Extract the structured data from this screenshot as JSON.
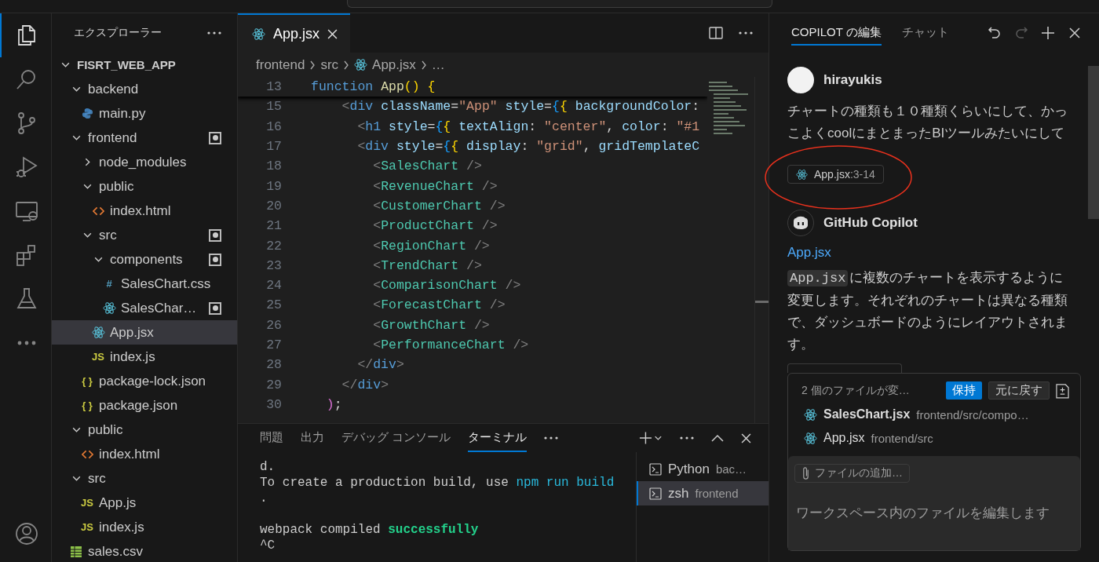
{
  "activity_bar": [
    {
      "kind": "explorer",
      "selected": true
    },
    {
      "kind": "search",
      "selected": false
    },
    {
      "kind": "source-control",
      "selected": false
    },
    {
      "kind": "run-debug",
      "selected": false
    },
    {
      "kind": "remote",
      "selected": false
    },
    {
      "kind": "extensions",
      "selected": false
    },
    {
      "kind": "testing",
      "selected": false
    },
    {
      "kind": "more",
      "selected": false
    },
    {
      "kind": "account",
      "selected": false
    }
  ],
  "explorer": {
    "title": "エクスプローラー",
    "tree": [
      {
        "name": "FISRT_WEB_APP",
        "kind": "workspace",
        "expanded": true,
        "modified": false,
        "selected": false,
        "children": [
          {
            "name": "backend",
            "kind": "folder",
            "expanded": true,
            "modified": false,
            "selected": false,
            "children": [
              {
                "name": "main.py",
                "kind": "python",
                "modified": false,
                "selected": false
              }
            ]
          },
          {
            "name": "frontend",
            "kind": "folder",
            "expanded": true,
            "modified": true,
            "selected": false,
            "children": [
              {
                "name": "node_modules",
                "kind": "folder",
                "expanded": false,
                "modified": false,
                "selected": false
              },
              {
                "name": "public",
                "kind": "folder",
                "expanded": true,
                "modified": false,
                "selected": false,
                "children": [
                  {
                    "name": "index.html",
                    "kind": "html",
                    "modified": false,
                    "selected": false
                  }
                ]
              },
              {
                "name": "src",
                "kind": "folder",
                "expanded": true,
                "modified": true,
                "selected": false,
                "children": [
                  {
                    "name": "components",
                    "kind": "folder",
                    "expanded": true,
                    "modified": true,
                    "selected": false,
                    "children": [
                      {
                        "name": "SalesChart.css",
                        "kind": "glyph",
                        "glyph": "#",
                        "modified": false,
                        "selected": false
                      },
                      {
                        "name": "SalesChar…",
                        "kind": "react",
                        "modified": true,
                        "selected": false
                      }
                    ]
                  },
                  {
                    "name": "App.jsx",
                    "kind": "react",
                    "modified": false,
                    "selected": true
                  },
                  {
                    "name": "index.js",
                    "kind": "glyph",
                    "glyph": "JS",
                    "modified": false,
                    "selected": false
                  }
                ]
              },
              {
                "name": "package-lock.json",
                "kind": "glyph",
                "glyph": "{ }",
                "modified": false,
                "selected": false
              },
              {
                "name": "package.json",
                "kind": "glyph",
                "glyph": "{ }",
                "modified": false,
                "selected": false
              }
            ]
          },
          {
            "name": "public",
            "kind": "folder",
            "expanded": true,
            "modified": false,
            "selected": false,
            "children": [
              {
                "name": "index.html",
                "kind": "html",
                "modified": false,
                "selected": false
              }
            ]
          },
          {
            "name": "src",
            "kind": "folder",
            "expanded": true,
            "modified": false,
            "selected": false,
            "children": [
              {
                "name": "App.js",
                "kind": "glyph",
                "glyph": "JS",
                "modified": false,
                "selected": false
              },
              {
                "name": "index.js",
                "kind": "glyph",
                "glyph": "JS",
                "modified": false,
                "selected": false
              }
            ]
          },
          {
            "name": "sales.csv",
            "kind": "csv",
            "modified": false,
            "selected": false
          }
        ]
      }
    ]
  },
  "editor": {
    "tabs": [
      {
        "label": "App.jsx",
        "kind": "react",
        "selected": true
      }
    ],
    "breadcrumbs": [
      {
        "text": "frontend",
        "kind": "plain"
      },
      {
        "text": "src",
        "kind": "plain"
      },
      {
        "text": "App.jsx",
        "kind": "react"
      },
      {
        "text": "…",
        "kind": "plain"
      }
    ],
    "sticky_line": {
      "number": "13",
      "tokens": [
        {
          "kind": "keyword",
          "text": "function "
        },
        {
          "kind": "func",
          "text": "App"
        },
        {
          "kind": "brace1",
          "text": "() {"
        }
      ]
    },
    "lines": [
      {
        "number": "15",
        "tokens": [
          {
            "kind": "bracket",
            "text": "    <"
          },
          {
            "kind": "tag",
            "text": "div"
          },
          {
            "kind": "attr",
            "text": " className"
          },
          {
            "kind": "punct",
            "text": "="
          },
          {
            "kind": "string",
            "text": "\"App\""
          },
          {
            "kind": "attr",
            "text": " style"
          },
          {
            "kind": "punct",
            "text": "="
          },
          {
            "kind": "brace3",
            "text": "{"
          },
          {
            "kind": "brace1",
            "text": "{"
          },
          {
            "kind": "attr",
            "text": " backgroundColor"
          },
          {
            "kind": "punct",
            "text": ":"
          }
        ]
      },
      {
        "number": "16",
        "tokens": [
          {
            "kind": "bracket",
            "text": "      <"
          },
          {
            "kind": "tag",
            "text": "h1"
          },
          {
            "kind": "attr",
            "text": " style"
          },
          {
            "kind": "punct",
            "text": "="
          },
          {
            "kind": "brace3",
            "text": "{"
          },
          {
            "kind": "brace1",
            "text": "{"
          },
          {
            "kind": "attr",
            "text": " textAlign"
          },
          {
            "kind": "punct",
            "text": ": "
          },
          {
            "kind": "string",
            "text": "\"center\""
          },
          {
            "kind": "punct",
            "text": ", "
          },
          {
            "kind": "attr",
            "text": "color"
          },
          {
            "kind": "punct",
            "text": ": "
          },
          {
            "kind": "string",
            "text": "\"#1"
          }
        ]
      },
      {
        "number": "17",
        "tokens": [
          {
            "kind": "bracket",
            "text": "      <"
          },
          {
            "kind": "tag",
            "text": "div"
          },
          {
            "kind": "attr",
            "text": " style"
          },
          {
            "kind": "punct",
            "text": "="
          },
          {
            "kind": "brace3",
            "text": "{"
          },
          {
            "kind": "brace1",
            "text": "{"
          },
          {
            "kind": "attr",
            "text": " display"
          },
          {
            "kind": "punct",
            "text": ": "
          },
          {
            "kind": "string",
            "text": "\"grid\""
          },
          {
            "kind": "punct",
            "text": ", "
          },
          {
            "kind": "attr",
            "text": "gridTemplateC"
          }
        ]
      },
      {
        "number": "18",
        "tokens": [
          {
            "kind": "bracket",
            "text": "        <"
          },
          {
            "kind": "component",
            "text": "SalesChart"
          },
          {
            "kind": "bracket",
            "text": " />"
          }
        ]
      },
      {
        "number": "19",
        "tokens": [
          {
            "kind": "bracket",
            "text": "        <"
          },
          {
            "kind": "component",
            "text": "RevenueChart"
          },
          {
            "kind": "bracket",
            "text": " />"
          }
        ]
      },
      {
        "number": "20",
        "tokens": [
          {
            "kind": "bracket",
            "text": "        <"
          },
          {
            "kind": "component",
            "text": "CustomerChart"
          },
          {
            "kind": "bracket",
            "text": " />"
          }
        ]
      },
      {
        "number": "21",
        "tokens": [
          {
            "kind": "bracket",
            "text": "        <"
          },
          {
            "kind": "component",
            "text": "ProductChart"
          },
          {
            "kind": "bracket",
            "text": " />"
          }
        ]
      },
      {
        "number": "22",
        "tokens": [
          {
            "kind": "bracket",
            "text": "        <"
          },
          {
            "kind": "component",
            "text": "RegionChart"
          },
          {
            "kind": "bracket",
            "text": " />"
          }
        ]
      },
      {
        "number": "23",
        "tokens": [
          {
            "kind": "bracket",
            "text": "        <"
          },
          {
            "kind": "component",
            "text": "TrendChart"
          },
          {
            "kind": "bracket",
            "text": " />"
          }
        ]
      },
      {
        "number": "24",
        "tokens": [
          {
            "kind": "bracket",
            "text": "        <"
          },
          {
            "kind": "component",
            "text": "ComparisonChart"
          },
          {
            "kind": "bracket",
            "text": " />"
          }
        ]
      },
      {
        "number": "25",
        "tokens": [
          {
            "kind": "bracket",
            "text": "        <"
          },
          {
            "kind": "component",
            "text": "ForecastChart"
          },
          {
            "kind": "bracket",
            "text": " />"
          }
        ]
      },
      {
        "number": "26",
        "tokens": [
          {
            "kind": "bracket",
            "text": "        <"
          },
          {
            "kind": "component",
            "text": "GrowthChart"
          },
          {
            "kind": "bracket",
            "text": " />"
          }
        ]
      },
      {
        "number": "27",
        "tokens": [
          {
            "kind": "bracket",
            "text": "        <"
          },
          {
            "kind": "component",
            "text": "PerformanceChart"
          },
          {
            "kind": "bracket",
            "text": " />"
          }
        ]
      },
      {
        "number": "28",
        "tokens": [
          {
            "kind": "bracket",
            "text": "      </"
          },
          {
            "kind": "tag",
            "text": "div"
          },
          {
            "kind": "bracket",
            "text": ">"
          }
        ]
      },
      {
        "number": "29",
        "tokens": [
          {
            "kind": "bracket",
            "text": "    </"
          },
          {
            "kind": "tag",
            "text": "div"
          },
          {
            "kind": "bracket",
            "text": ">"
          }
        ]
      },
      {
        "number": "30",
        "tokens": [
          {
            "kind": "brace2",
            "text": "  )"
          },
          {
            "kind": "punct",
            "text": ";"
          }
        ]
      }
    ]
  },
  "panel": {
    "tabs": [
      {
        "label": "問題",
        "selected": false
      },
      {
        "label": "出力",
        "selected": false
      },
      {
        "label": "デバッグ コンソール",
        "selected": false
      },
      {
        "label": "ターミナル",
        "selected": true
      }
    ],
    "terminal": [
      {
        "kind": "text",
        "segments": [
          {
            "kind": "plain",
            "text": "d."
          }
        ]
      },
      {
        "kind": "text",
        "segments": [
          {
            "kind": "plain",
            "text": "To create a production build, use "
          },
          {
            "kind": "command",
            "text": "npm run build"
          }
        ]
      },
      {
        "kind": "text",
        "segments": [
          {
            "kind": "plain",
            "text": "."
          }
        ]
      },
      {
        "kind": "blank"
      },
      {
        "kind": "text",
        "segments": [
          {
            "kind": "plain",
            "text": "webpack compiled "
          },
          {
            "kind": "success",
            "text": "successfully"
          }
        ]
      },
      {
        "kind": "text",
        "segments": [
          {
            "kind": "plain",
            "text": "^C"
          }
        ]
      }
    ],
    "terminals": [
      {
        "name": "Python",
        "detail": "bac…",
        "selected": false
      },
      {
        "name": "zsh",
        "detail": "frontend",
        "selected": true
      }
    ]
  },
  "copilot": {
    "tabs": [
      {
        "label": "COPILOT の編集",
        "selected": true
      },
      {
        "label": "チャット",
        "selected": false
      }
    ],
    "actions": [
      {
        "kind": "undo",
        "disabled": false
      },
      {
        "kind": "redo",
        "disabled": true
      },
      {
        "kind": "new",
        "disabled": false
      },
      {
        "kind": "close",
        "disabled": false
      }
    ],
    "user": {
      "author": "hirayukis",
      "text": "チャートの種類も１０種類くらいにして、かっこよくcoolにまとまったBIツールみたいにして",
      "reference": {
        "file": "App.jsx",
        "lines": ":3-14"
      },
      "annotated": true
    },
    "assistant": {
      "author": "GitHub Copilot",
      "link": "App.jsx",
      "code": "App.jsx",
      "text": "に複数のチャートを表示するように変更します。それぞれのチャートは異なる種類で、ダッシュボードのようにレイアウトされます。"
    },
    "changes": {
      "summary": "2 個のファイルが変…",
      "keep": "保持",
      "undo": "元に戻す",
      "files": [
        {
          "name": "SalesChart.jsx",
          "path": "frontend/src/compo…",
          "kind": "react"
        },
        {
          "name": "App.jsx",
          "path": "frontend/src",
          "kind": "react"
        }
      ]
    },
    "input": {
      "attach": "ファイルの追加…",
      "placeholder": "ワークスペース内のファイルを編集します"
    }
  }
}
